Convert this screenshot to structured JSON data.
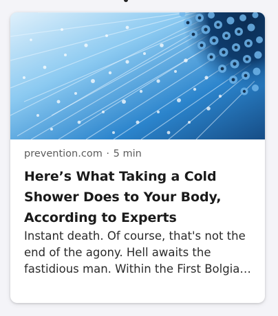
{
  "card": {
    "source": "prevention.com",
    "separator": "·",
    "read_time": "5 min",
    "title": "Here’s What Taking a Cold Shower Does to Your Body, According to Experts",
    "snippet": "Instant death. Of course, that's not the end of the agony. Hell awaits the fastidious man. Within the First Bolgia, w...",
    "image_icon": "shower-head-image"
  },
  "colors": {
    "card_background": "#ffffff",
    "page_background": "#f4f4f8",
    "title_color": "#1a1a1a",
    "meta_color": "#5b5b5b"
  }
}
